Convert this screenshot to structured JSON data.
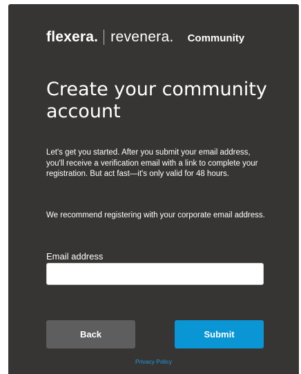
{
  "brand": {
    "flexera": "flexera",
    "flexera_dot": ".",
    "revenera": "revenera.",
    "community": "Community"
  },
  "title": "Create your community account",
  "intro": "Let's get you started. After you submit your email address, you'll receive a verification email with a link to complete your registration. But act fast—it's only valid for 48 hours.",
  "recommend": "We recommend registering with your corporate email address.",
  "email": {
    "label": "Email address",
    "value": "",
    "placeholder": ""
  },
  "buttons": {
    "back": "Back",
    "submit": "Submit"
  },
  "footer": {
    "privacy": "Privacy Policy"
  },
  "colors": {
    "panel": "#373534",
    "submit": "#0a95d4",
    "back": "#5e5e5e",
    "link": "#1a9be0"
  }
}
